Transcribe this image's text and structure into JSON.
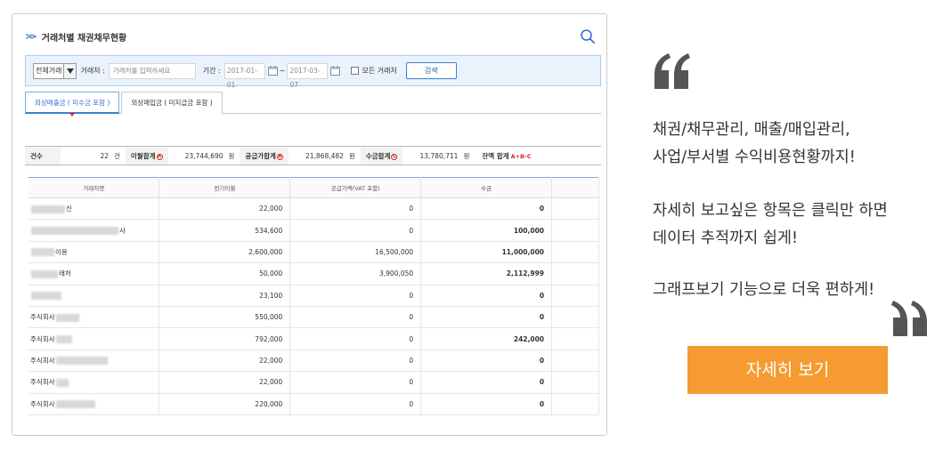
{
  "app": {
    "title": "거래처별 채권채무현황"
  },
  "filter": {
    "type_value": "전체거래",
    "client_label": "거래처 :",
    "client_placeholder": "거래처를 입력하세요",
    "period_label": "기간 :",
    "date_from": "2017-01-01",
    "date_sep": "~",
    "date_to": "2017-03-07",
    "all_clients_label": "모든 거래처",
    "all_clients_checked": false,
    "search_label": "검색"
  },
  "tabs": [
    {
      "label": "외상매출금 ( 미수금 포함 )",
      "active": true
    },
    {
      "label": "외상매입금 ( 미지급금 포함 )",
      "active": false
    }
  ],
  "summary": {
    "count_label": "건수",
    "count_value": "22",
    "count_unit": "건",
    "carry_label": "이월합계",
    "carry_mark": "A",
    "carry_value": "23,744,690",
    "carry_unit": "원",
    "supply_label": "공급가합계",
    "supply_mark": "B",
    "supply_value": "21,868,482",
    "supply_unit": "원",
    "receipt_label": "수금합계",
    "receipt_mark": "C",
    "receipt_value": "13,780,711",
    "receipt_unit": "원",
    "balance_label": "잔액 합계",
    "balance_formula": "A+B-C"
  },
  "table": {
    "columns": [
      "거래처명",
      "전기이월",
      "공급가액(VAT 포함)",
      "수금"
    ],
    "rows": [
      {
        "name": "신",
        "carry": "22,000",
        "supply": "0",
        "receipt": "0"
      },
      {
        "name": "사",
        "carry": "534,600",
        "supply": "0",
        "receipt": "100,000"
      },
      {
        "name": "이용",
        "carry": "2,600,000",
        "supply": "16,500,000",
        "receipt": "11,000,000"
      },
      {
        "name": "래처",
        "carry": "50,000",
        "supply": "3,900,050",
        "receipt": "2,112,999"
      },
      {
        "name": "",
        "carry": "23,100",
        "supply": "0",
        "receipt": "0"
      },
      {
        "name": "주식회사",
        "carry": "550,000",
        "supply": "0",
        "receipt": "0"
      },
      {
        "name": "주식회사",
        "carry": "792,000",
        "supply": "0",
        "receipt": "242,000"
      },
      {
        "name": "주식회사",
        "carry": "22,000",
        "supply": "0",
        "receipt": "0"
      },
      {
        "name": "주식회사",
        "carry": "22,000",
        "supply": "0",
        "receipt": "0"
      },
      {
        "name": "주식회사",
        "carry": "220,000",
        "supply": "0",
        "receipt": "0"
      }
    ]
  },
  "promo": {
    "lines_1": [
      "채권/채무관리, 매출/매입관리,",
      "사업/부서별 수익비용현황까지!"
    ],
    "lines_2": [
      "자세히 보고싶은 항목은 클릭만 하면",
      "데이터 추적까지 쉽게!"
    ],
    "lines_3": [
      "그래프보기 기능으로 더욱 편하게!"
    ],
    "cta_label": "자세히 보기",
    "cta_color": "#f59b32"
  }
}
